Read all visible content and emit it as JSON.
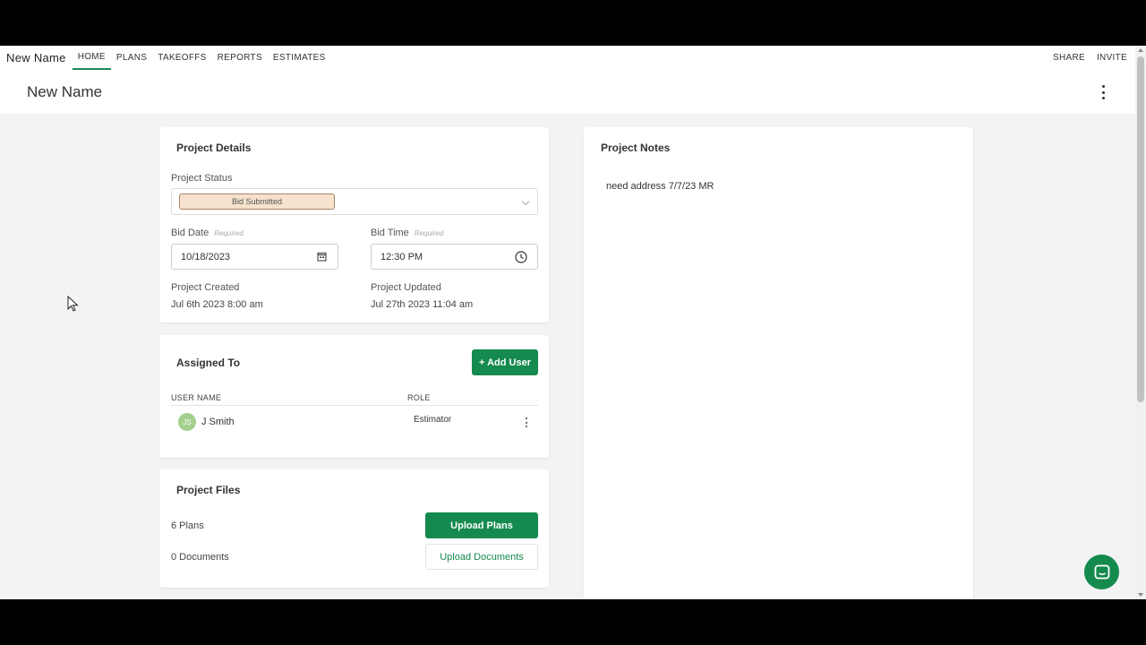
{
  "nav": {
    "brand": "New Name",
    "links": [
      "HOME",
      "PLANS",
      "TAKEOFFS",
      "REPORTS",
      "ESTIMATES"
    ],
    "share": "SHARE",
    "invite": "INVITE"
  },
  "header": {
    "title": "New Name"
  },
  "project_details": {
    "title": "Project Details",
    "status_label": "Project Status",
    "status_value": "Bid Submitted",
    "bid_date_label": "Bid Date",
    "bid_time_label": "Bid Time",
    "required": "Required",
    "bid_date": "10/18/2023",
    "bid_time": "12:30 PM",
    "created_label": "Project Created",
    "created_value": "Jul 6th 2023 8:00 am",
    "updated_label": "Project Updated",
    "updated_value": "Jul 27th 2023 11:04 am"
  },
  "assigned": {
    "title": "Assigned To",
    "add_user": "+ Add User",
    "col_user": "USER NAME",
    "col_role": "ROLE",
    "rows": [
      {
        "initials": "JS",
        "name": "J Smith",
        "role": "Estimator"
      }
    ]
  },
  "files": {
    "title": "Project Files",
    "plans": "6 Plans",
    "documents": "0 Documents",
    "upload_plans": "Upload Plans",
    "upload_documents": "Upload Documents"
  },
  "notes": {
    "title": "Project Notes",
    "text": "need address 7/7/23 MR"
  },
  "colors": {
    "accent": "#158a4f",
    "chip_bg": "#f6e2cc",
    "avatar": "#a4cf8d"
  }
}
